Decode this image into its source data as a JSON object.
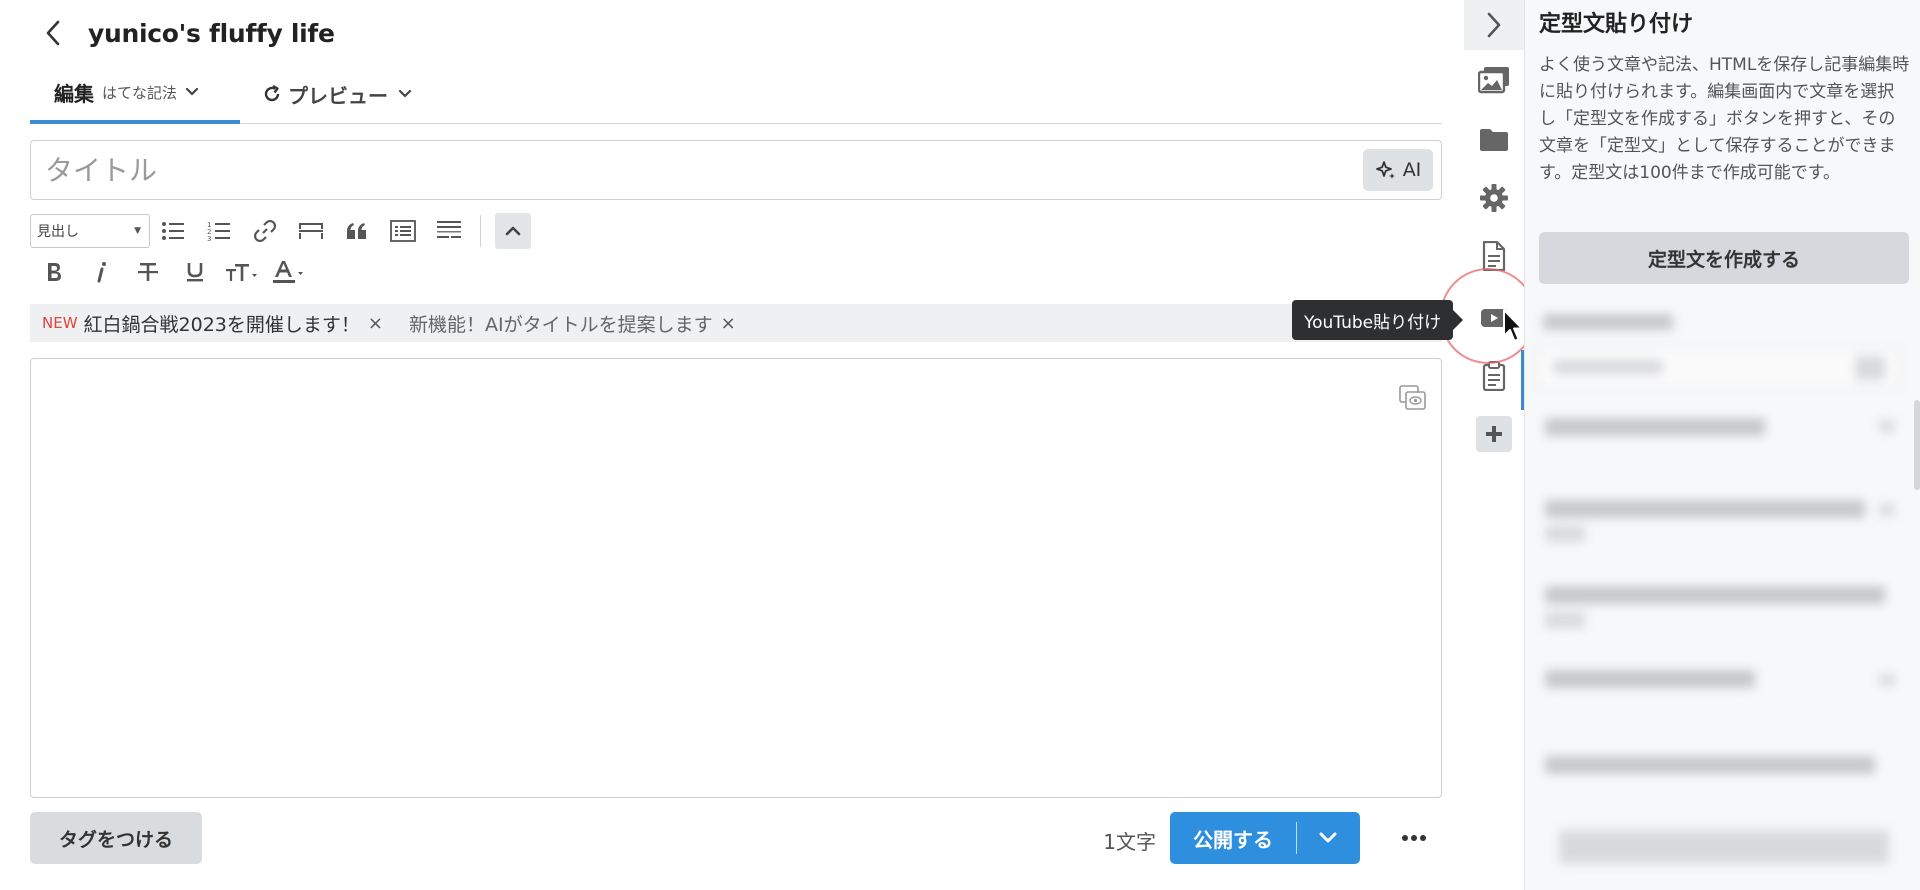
{
  "header": {
    "blog_title": "yunico's fluffy life"
  },
  "tabs": {
    "edit_label": "編集",
    "edit_mode": "はてな記法",
    "preview_label": "プレビュー"
  },
  "title_field": {
    "placeholder": "タイトル",
    "ai_label": "AI"
  },
  "toolbar": {
    "heading_select": "見出し"
  },
  "notice": {
    "new_badge": "NEW",
    "item1": "紅白鍋合戦2023を開催します！",
    "item2": "新機能！AIがタイトルを提案します",
    "close": "×"
  },
  "footer": {
    "tag_button": "タグをつける",
    "char_count": "1文字",
    "publish_button": "公開する"
  },
  "tooltip": {
    "text": "YouTube貼り付け"
  },
  "panel": {
    "title": "定型文貼り付け",
    "description": "よく使う文章や記法、HTMLを保存し記事編集時に貼り付けられます。編集画面内で文章を選択し「定型文を作成する」ボタンを押すと、その文章を「定型文」として保存することができます。定型文は100件まで作成可能です。",
    "create_button": "定型文を作成する"
  },
  "colors": {
    "accent": "#3b8bd4",
    "publish": "#2e8fde",
    "new_badge": "#e0443e"
  }
}
